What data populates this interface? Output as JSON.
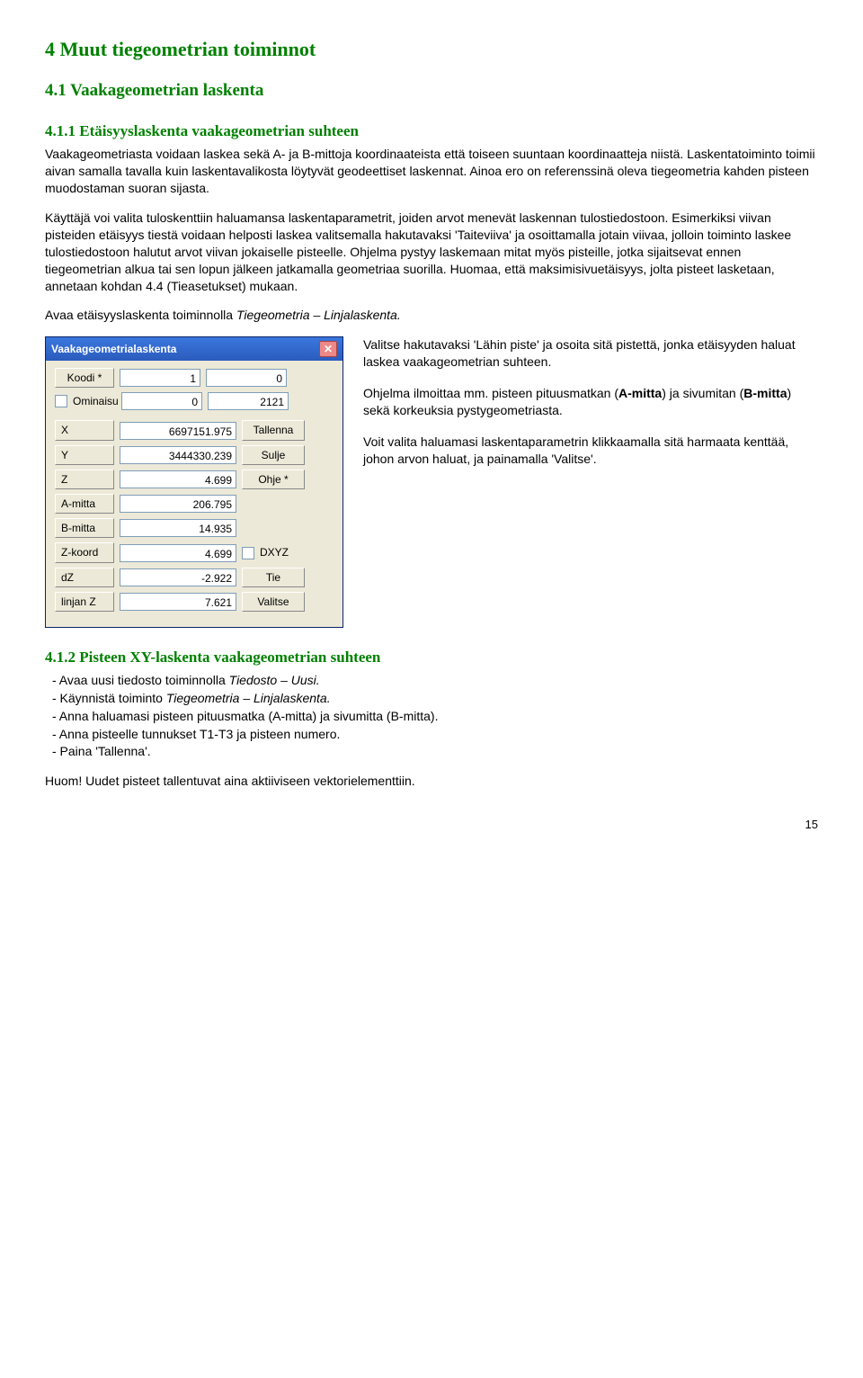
{
  "h1": "4  Muut tiegeometrian toiminnot",
  "h2": "4.1  Vaakageometrian laskenta",
  "h3_1": "4.1.1  Etäisyyslaskenta vaakageometrian suhteen",
  "p1": "Vaakageometriasta voidaan laskea sekä A- ja B-mittoja koordinaateista että toiseen suuntaan koordinaatteja niistä. Laskentatoiminto toimii aivan samalla tavalla kuin laskentavalikosta löytyvät geodeettiset laskennat. Ainoa ero on referenssinä oleva tiegeometria kahden pisteen muodostaman suoran sijasta.",
  "p2a": "Käyttäjä voi valita tuloskenttiin haluamansa laskentaparametrit, joiden arvot menevät laskennan tulostiedostoon. Esimerkiksi viivan pisteiden etäisyys tiestä voidaan helposti laskea valitsemalla hakutavaksi 'Taiteviiva' ja osoittamalla jotain viivaa, jolloin toiminto laskee tulostiedostoon halutut arvot viivan jokaiselle pisteelle. Ohjelma pystyy laskemaan mitat myös pisteille, jotka sijaitsevat ennen tiegeometrian alkua tai sen lopun jälkeen jatkamalla geometriaa suorilla. Huomaa, että maksimisivuetäisyys, jolta pisteet lasketaan, annetaan kohdan 4.4 (Tieasetukset) mukaan.",
  "p3a": "Avaa etäisyyslaskenta toiminnolla ",
  "p3b": "Tiegeometria – Linjalaskenta.",
  "dlg": {
    "title": "Vaakageometrialaskenta",
    "koodi_btn": "Koodi *",
    "koodi_v1": "1",
    "koodi_v2": "0",
    "ominaisu_lbl": "Ominaisu",
    "ominaisu_v1": "0",
    "ominaisu_v2": "2121",
    "tallenna": "Tallenna",
    "sulje": "Sulje",
    "ohje": "Ohje *",
    "rows": [
      {
        "label": "X",
        "val": "6697151.975"
      },
      {
        "label": "Y",
        "val": "3444330.239"
      },
      {
        "label": "Z",
        "val": "4.699"
      },
      {
        "label": "A-mitta",
        "val": "206.795"
      },
      {
        "label": "B-mitta",
        "val": "14.935"
      },
      {
        "label": "Z-koord",
        "val": "4.699"
      },
      {
        "label": "dZ",
        "val": "-2.922"
      },
      {
        "label": "linjan Z",
        "val": "7.621"
      }
    ],
    "dxyz": "DXYZ",
    "tie": "Tie",
    "valitse": "Valitse"
  },
  "side": {
    "p1": "Valitse hakutavaksi 'Lähin piste' ja osoita sitä pistettä, jonka etäisyyden haluat laskea vaakageometrian suhteen.",
    "p2a": "Ohjelma ilmoittaa mm. pisteen pituusmatkan (",
    "p2b": "A-mitta",
    "p2c": ") ja sivumitan (",
    "p2d": "B-mitta",
    "p2e": ") sekä korkeuksia pystygeometriasta.",
    "p3": "Voit valita haluamasi laskentaparametrin klikkaamalla sitä harmaata kenttää, johon arvon haluat, ja painamalla 'Valitse'."
  },
  "h3_2": "4.1.2  Pisteen XY-laskenta vaakageometrian suhteen",
  "list": [
    "-  Avaa uusi tiedosto toiminnolla Tiedosto – Uusi.",
    "-  Käynnistä toiminto Tiegeometria – Linjalaskenta.",
    "-  Anna haluamasi pisteen pituusmatka (A-mitta) ja sivumitta (B-mitta).",
    "-  Anna pisteelle tunnukset T1-T3 ja pisteen numero.",
    "-  Paina 'Tallenna'."
  ],
  "list_items": [
    {
      "pre": "-  Avaa uusi tiedosto toiminnolla ",
      "it": "Tiedosto – Uusi."
    },
    {
      "pre": "-  Käynnistä toiminto ",
      "it": "Tiegeometria – Linjalaskenta."
    },
    {
      "plain": "-  Anna haluamasi pisteen pituusmatka (A-mitta) ja sivumitta (B-mitta)."
    },
    {
      "plain": "-  Anna pisteelle tunnukset T1-T3 ja pisteen numero."
    },
    {
      "plain": "-  Paina 'Tallenna'."
    }
  ],
  "p_last": "Huom! Uudet pisteet tallentuvat aina aktiiviseen vektorielementtiin.",
  "pagenum": "15"
}
